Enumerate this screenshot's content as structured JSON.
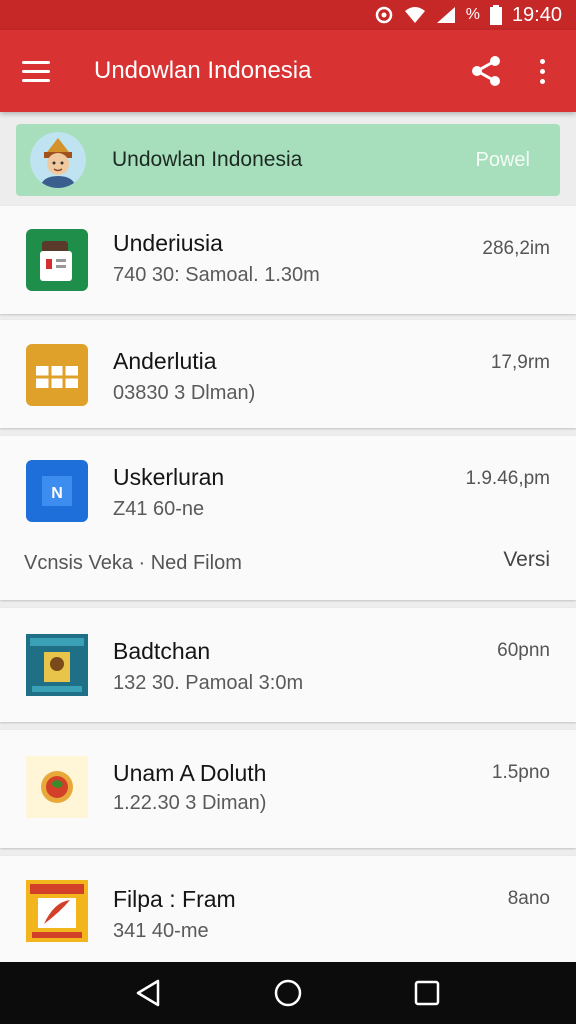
{
  "status_bar": {
    "time": "19:40",
    "battery_pct_label": "%",
    "icons": [
      "hotspot-icon",
      "wifi-icon",
      "signal-icon",
      "battery-icon"
    ]
  },
  "app_bar": {
    "title": "Undowlan Indonesia",
    "icons": [
      "menu-icon",
      "share-icon",
      "more-vert-icon"
    ]
  },
  "banner": {
    "title": "Undowlan Indonesia",
    "action": "Powel"
  },
  "items": [
    {
      "name": "Underiusia",
      "sub": "740 30: Samoal. 1.30m",
      "size": "286,2im",
      "icon": "spreadsheet-app-icon",
      "icon_color": "#1e8e4a"
    },
    {
      "name": "Anderlutia",
      "sub": "03830 3 Dlman)",
      "size": "17,9rm",
      "icon": "table-app-icon",
      "icon_color": "#e0a12a"
    },
    {
      "name": "Uskerluran",
      "sub": "Z41 60-ne",
      "size": "1.9.46,pm",
      "icon": "document-app-icon",
      "icon_color": "#1e6fd9",
      "extra_left": "Vcnsis  Veka  ·  Ned Filom",
      "extra_right": "Versi"
    },
    {
      "name": "Badtchan",
      "sub": "132 30. Pamoal 3:0m",
      "size": "60pnn",
      "icon": "book-cover-icon",
      "icon_color": "#1f6f86"
    },
    {
      "name": "Unam A Doluth",
      "sub": "1.22.30 3 Diman)",
      "size": "1.5pno",
      "icon": "food-icon",
      "icon_color": "#fff6d8"
    },
    {
      "name": "Filpa : Fram",
      "sub": "341 40-me",
      "size": "8ano",
      "icon": "book-cover-icon",
      "icon_color": "#f2b51c"
    }
  ],
  "nav_bar": {
    "icons": [
      "back-icon",
      "home-icon",
      "recents-icon"
    ]
  }
}
